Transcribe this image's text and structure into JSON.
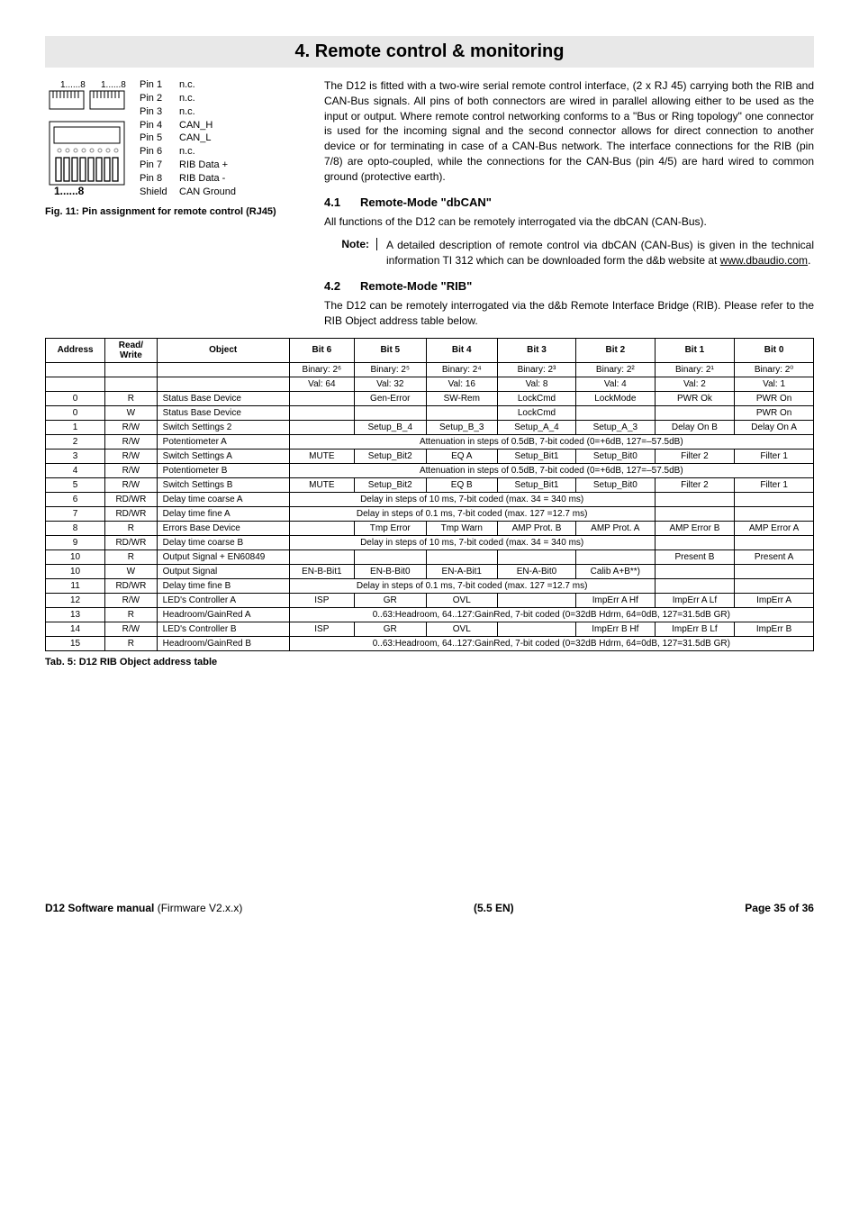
{
  "title": "4. Remote control & monitoring",
  "pinDiagram": {
    "topLabels": {
      "a": "1......8",
      "b": "1......8"
    },
    "bottomLabel": "1......8",
    "rows": [
      {
        "pin": "Pin 1",
        "sig": "n.c."
      },
      {
        "pin": "Pin 2",
        "sig": "n.c."
      },
      {
        "pin": "Pin 3",
        "sig": "n.c."
      },
      {
        "pin": "Pin 4",
        "sig": "CAN_H"
      },
      {
        "pin": "Pin 5",
        "sig": "CAN_L"
      },
      {
        "pin": "Pin 6",
        "sig": "n.c."
      },
      {
        "pin": "Pin 7",
        "sig": "RIB Data +"
      },
      {
        "pin": "Pin 8",
        "sig": "RIB Data -"
      },
      {
        "pin": "Shield",
        "sig": "CAN Ground"
      }
    ],
    "caption": "Fig. 11: Pin assignment for remote control (RJ45)"
  },
  "intro": "The D12 is fitted with a two-wire serial remote control interface, (2 x RJ 45) carrying both the RIB and CAN-Bus signals. All pins of both connectors are wired in parallel allowing either to be used as the input or output. Where remote control networking conforms to a \"Bus or Ring topology\" one connector is used for the incoming signal and the second connector allows for direct connection to another device or for terminating in case of a CAN-Bus network. The interface connections for the RIB (pin 7/8) are opto-coupled, while the connections for the CAN-Bus (pin 4/5) are hard wired to common ground (protective earth).",
  "sec41": {
    "num": "4.1",
    "title": "Remote-Mode \"dbCAN\"",
    "body": "All functions of the D12 can be remotely interrogated via the dbCAN (CAN-Bus)."
  },
  "note": {
    "label": "Note:",
    "body": "A detailed description of remote control via dbCAN (CAN-Bus) is given in the technical information TI 312 which can be downloaded form the d&b website at ",
    "link": "www.dbaudio.com",
    "after": "."
  },
  "sec42": {
    "num": "4.2",
    "title": "Remote-Mode \"RIB\"",
    "body": "The D12 can be remotely interrogated via the d&b Remote Interface Bridge (RIB). Please refer to the RIB Object address table below."
  },
  "table": {
    "head1": [
      "Address",
      "Read/\nWrite",
      "Object",
      "Bit 6",
      "Bit 5",
      "Bit 4",
      "Bit 3",
      "Bit 2",
      "Bit 1",
      "Bit 0"
    ],
    "binaryRow": [
      "",
      "",
      "",
      "Binary: 2⁶",
      "Binary: 2⁵",
      "Binary: 2⁴",
      "Binary: 2³",
      "Binary: 2²",
      "Binary: 2¹",
      "Binary: 2⁰"
    ],
    "valRow": [
      "",
      "",
      "",
      "Val: 64",
      "Val: 32",
      "Val: 16",
      "Val: 8",
      "Val: 4",
      "Val: 2",
      "Val: 1"
    ],
    "rows": [
      {
        "a": "0",
        "rw": "R",
        "obj": "Status Base Device",
        "b6": "",
        "b5": "Gen-Error",
        "b4": "SW-Rem",
        "b3": "LockCmd",
        "b2": "LockMode",
        "b1": "PWR Ok",
        "b0": "PWR On"
      },
      {
        "a": "0",
        "rw": "W",
        "obj": "Status Base Device",
        "b6": "",
        "b5": "",
        "b4": "",
        "b3": "LockCmd",
        "b2": "",
        "b1": "",
        "b0": "PWR On"
      },
      {
        "a": "1",
        "rw": "R/W",
        "obj": "Switch Settings 2",
        "b6": "",
        "b5": "Setup_B_4",
        "b4": "Setup_B_3",
        "b3": "Setup_A_4",
        "b2": "Setup_A_3",
        "b1": "Delay On B",
        "b0": "Delay On A"
      },
      {
        "a": "2",
        "rw": "R/W",
        "obj": "Potentiometer A",
        "span": "Attenuation in steps of 0.5dB, 7-bit coded (0=+6dB, 127=–57.5dB)"
      },
      {
        "a": "3",
        "rw": "R/W",
        "obj": "Switch Settings A",
        "b6": "MUTE",
        "b5": "Setup_Bit2",
        "b4": "EQ A",
        "b3": "Setup_Bit1",
        "b2": "Setup_Bit0",
        "b1": "Filter 2",
        "b0": "Filter 1"
      },
      {
        "a": "4",
        "rw": "R/W",
        "obj": "Potentiometer B",
        "span": "Attenuation in steps of 0.5dB, 7-bit coded (0=+6dB, 127=–57.5dB)"
      },
      {
        "a": "5",
        "rw": "R/W",
        "obj": "Switch Settings B",
        "b6": "MUTE",
        "b5": "Setup_Bit2",
        "b4": "EQ B",
        "b3": "Setup_Bit1",
        "b2": "Setup_Bit0",
        "b1": "Filter 2",
        "b0": "Filter 1"
      },
      {
        "a": "6",
        "rw": "RD/WR",
        "obj": "Delay time coarse A",
        "span5": "Delay in steps of 10 ms, 7-bit coded (max. 34 = 340 ms)"
      },
      {
        "a": "7",
        "rw": "RD/WR",
        "obj": "Delay time fine A",
        "span5": "Delay in steps of 0.1 ms, 7-bit coded (max. 127 =12.7 ms)"
      },
      {
        "a": "8",
        "rw": "R",
        "obj": "Errors Base Device",
        "b6": "",
        "b5": "Tmp Error",
        "b4": "Tmp Warn",
        "b3": "AMP Prot. B",
        "b2": "AMP Prot. A",
        "b1": "AMP Error B",
        "b0": "AMP Error A"
      },
      {
        "a": "9",
        "rw": "RD/WR",
        "obj": "Delay time coarse B",
        "span5": "Delay in steps of 10 ms, 7-bit coded (max. 34 = 340 ms)"
      },
      {
        "a": "10",
        "rw": "R",
        "obj": "Output Signal + EN60849",
        "b6": "",
        "b5": "",
        "b4": "",
        "b3": "",
        "b2": "",
        "b1": "Present B",
        "b0": "Present A"
      },
      {
        "a": "10",
        "rw": "W",
        "obj": "Output Signal",
        "b6": "EN-B-Bit1",
        "b5": "EN-B-Bit0",
        "b4": "EN-A-Bit1",
        "b3": "EN-A-Bit0",
        "b2": "Calib A+B**)",
        "b1": "",
        "b0": ""
      },
      {
        "a": "11",
        "rw": "RD/WR",
        "obj": "Delay time fine B",
        "span5": "Delay in steps of 0.1 ms, 7-bit coded (max. 127 =12.7 ms)"
      },
      {
        "a": "12",
        "rw": "R/W",
        "obj": "LED's Controller A",
        "b6": "ISP",
        "b5": "GR",
        "b4": "OVL",
        "b3": "",
        "b2": "ImpErr A Hf",
        "b1": "ImpErr A Lf",
        "b0": "ImpErr A"
      },
      {
        "a": "13",
        "rw": "R",
        "obj": "Headroom/GainRed A",
        "span": "0..63:Headroom, 64..127:GainRed, 7-bit coded (0=32dB Hdrm, 64=0dB, 127=31.5dB GR)"
      },
      {
        "a": "14",
        "rw": "R/W",
        "obj": "LED's Controller B",
        "b6": "ISP",
        "b5": "GR",
        "b4": "OVL",
        "b3": "",
        "b2": "ImpErr B Hf",
        "b1": "ImpErr B Lf",
        "b0": "ImpErr B"
      },
      {
        "a": "15",
        "rw": "R",
        "obj": "Headroom/GainRed B",
        "span": "0..63:Headroom, 64..127:GainRed, 7-bit coded (0=32dB Hdrm, 64=0dB, 127=31.5dB GR)"
      }
    ],
    "caption": "Tab. 5: D12 RIB Object address table"
  },
  "footer": {
    "leftBold": "D12 Software manual",
    "leftRest": " (Firmware V2.x.x)",
    "mid": "(5.5 EN)",
    "right": "Page 35 of 36"
  }
}
